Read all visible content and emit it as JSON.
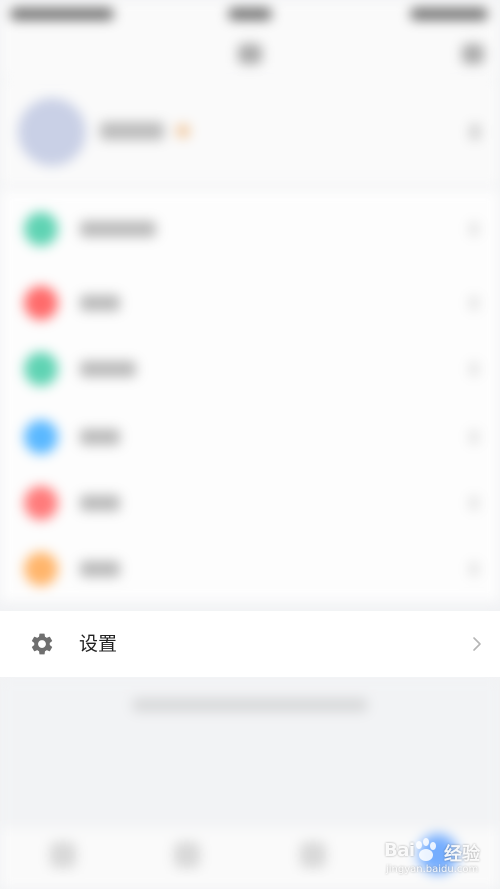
{
  "settings_row": {
    "label": "设置",
    "icon": "gear-icon",
    "chevron_icon": "chevron-right-icon"
  },
  "menu_icon_colors": [
    "#5fd3b3",
    "#ff6b6b",
    "#5fd3b3",
    "#5ab8ff",
    "#ff7b7b",
    "#ffb56b"
  ],
  "watermark": {
    "brand_latin": "Bai",
    "brand_cn": "经验",
    "url": "jingyan.baidu.com"
  }
}
